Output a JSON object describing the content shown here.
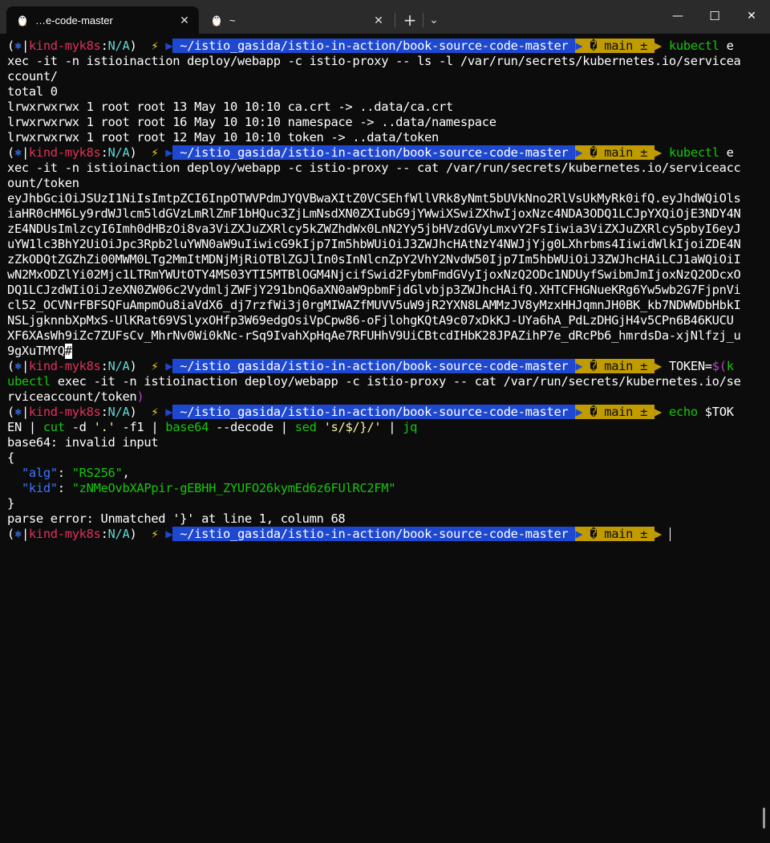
{
  "window": {
    "tabs": [
      {
        "title": "…e-code-master",
        "icon": "linux-tux-icon",
        "close": "✕"
      },
      {
        "title": "~",
        "icon": "linux-tux-icon",
        "close": "✕"
      }
    ],
    "new_tab": "+",
    "dropdown": "⌄",
    "minimize": "—",
    "maximize": "☐",
    "close": "✕"
  },
  "prompt": {
    "paren_open": "(",
    "k8s_icon": "⎈",
    "bar": "|",
    "context": "kind-myk8s",
    "colon": ":",
    "namespace": "N/A",
    "paren_close": ")",
    "bolt": "⚡",
    "path": "~/istio_gasida/istio-in-action/book-source-code-master",
    "branch": "� main ±",
    "sep": ""
  },
  "lines": {
    "l2": "xec -it -n istioinaction deploy/webapp -c istio-proxy -- ls -l /var/run/secrets/kubernetes.io/servicea",
    "l3": "ccount/",
    "l4": "total 0",
    "l5": "lrwxrwxrwx 1 root root 13 May 10 10:10 ca.crt -> ..data/ca.crt",
    "l6": "lrwxrwxrwx 1 root root 16 May 10 10:10 namespace -> ..data/namespace",
    "l7": "lrwxrwxrwx 1 root root 12 May 10 10:10 token -> ..data/token",
    "l9": "xec -it -n istioinaction deploy/webapp -c istio-proxy -- cat /var/run/secrets/kubernetes.io/serviceacc",
    "l10": "ount/token",
    "token": [
      "eyJhbGciOiJSUzI1NiIsImtpZCI6InpOTWVPdmJYQVBwaXItZ0VCSEhfWllVRk8yNmt5bUVkNno2RlVsUkMyRk0ifQ.eyJhdWQiOls",
      "iaHR0cHM6Ly9rdWJlcm5ldGVzLmRlZmF1bHQuc3ZjLmNsdXN0ZXIubG9jYWwiXSwiZXhwIjoxNzc4NDA3ODQ1LCJpYXQiOjE3NDY4N",
      "zE4NDUsImlzcyI6Imh0dHBzOi8va3ViZXJuZXRlcy5kZWZhdWx0LnN2Yy5jbHVzdGVyLmxvY2FsIiwia3ViZXJuZXRlcy5pbyI6eyJ",
      "uYW1lc3BhY2UiOiJpc3Rpb2luYWN0aW9uIiwicG9kIjp7Im5hbWUiOiJ3ZWJhcHAtNzY4NWJjYjg0LXhrbms4IiwidWlkIjoiZDE4N",
      "zZkODQtZGZhZi00MWM0LTg2MmItMDNjMjRiOTBlZGJlIn0sInNlcnZpY2VhY2NvdW50Ijp7Im5hbWUiOiJ3ZWJhcHAiLCJ1aWQiOiI",
      "wN2MxODZlYi02Mjc1LTRmYWUtOTY4MS03YTI5MTBlOGM4NjcifSwid2FybmFmdGVyIjoxNzQ2ODc1NDUyfSwibmJmIjoxNzQ2ODcxO",
      "DQ1LCJzdWIiOiJzeXN0ZW06c2VydmljZWFjY291bnQ6aXN0aW9pbmFjdGlvbjp3ZWJhcHAifQ.XHTCFHGNueKRg6Yw5wb2G7FjpnVi",
      "cl52_OCVNrFBFSQFuAmpmOu8iaVdX6_dj7rzfWi3j0rgMIWAZfMUVV5uW9jR2YXN8LAMMzJV8yMzxHHJqmnJH0BK_kb7NDWWDbHbkI",
      "NSLjgknnbXpMxS-UlKRat69VSlyxOHfp3W69edgOsiVpCpw86-oFjlohgKQtA9c07xDkKJ-UYa6hA_PdLzDHGjH4v5CPn6B46KUCU",
      "XF6XAsWh9iZc7ZUFsCv_MhrNv0Wi0kNc-rSq9IvahXpHqAe7RFUHhV9UiCBtcdIHbK28JPAZihP7e_dRcPb6_hmrdsDa-xjNlfzj_u",
      "9gXuTMYQ"
    ],
    "token_cursor": "#",
    "cmd3_tail_a": "TOKEN=",
    "cmd3_tail_b": "$(",
    "cmd3_tail_c": "k",
    "l22_a": "ubectl",
    "l22_b": " exec -it -n istioinaction deploy/webapp -c istio-proxy -- cat /var/run/secrets/kubernetes.io/se",
    "l23_a": "rviceaccount/token",
    "l23_b": ")",
    "cmd4_a": "echo",
    "cmd4_b": " $TOK",
    "l25": {
      "a": "EN | ",
      "b": "cut",
      "c": " -d ",
      "d": "'.'",
      "e": " -f1 | ",
      "f": "base64",
      "g": " --decode | ",
      "h": "sed",
      "i": " ",
      "j": "'s/$/}/'",
      "k": " | ",
      "l": "jq"
    },
    "l26": "base64: invalid input",
    "l27": "{",
    "json_alg_key": "\"alg\"",
    "json_alg_val": "\"RS256\"",
    "json_kid_key": "\"kid\"",
    "json_kid_val": "\"zNMeOvbXAPpir-gEBHH_ZYUFO26kymEd6z6FUlRC2FM\"",
    "l30": "}",
    "l31": "parse error: Unmatched '}' at line 1, column 68",
    "kubectl": "kubectl",
    "e_tail": " e"
  },
  "colors": {
    "background": "#0c0c0c",
    "path_segment": "#1f48d1",
    "git_segment": "#c19c00",
    "context": "#e0315a",
    "command": "#16c60c"
  }
}
